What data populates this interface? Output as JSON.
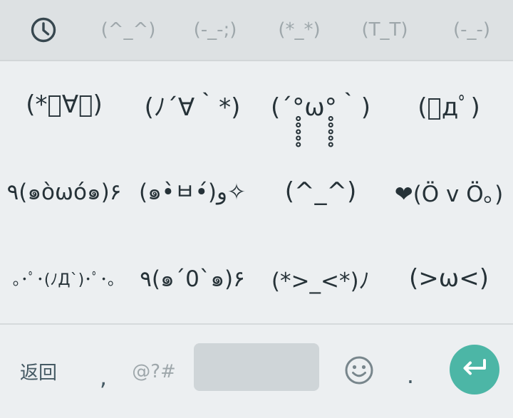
{
  "categories": {
    "recent_icon": "clock-icon",
    "items": [
      "(^_^)",
      "(-_-;)",
      "(*_*)",
      "(T_T)",
      "(-_-)"
    ]
  },
  "emoticons": [
    "(*ﾟ∀ﾟ)",
    "(ﾉ´∀｀*)",
    "(´°̥̥̥̥̥̥̥̥ω°̥̥̥̥̥̥̥̥｀)",
    "(ﾟдﾟ)",
    "٩(๑òωó๑)۶",
    "(๑•̀ㅂ•́)و✧",
    "(^_^)",
    "❤(Ö v Ö｡)",
    "｡･ﾟ･(ﾉД`)･ﾟ･｡",
    "٩(๑´0`๑)۶",
    "(*>_<*)ﾉ",
    "(>ω<)"
  ],
  "bottom": {
    "back_label": "返回",
    "comma_label": ",",
    "symbols_label": "@?#",
    "space_label": "",
    "emoji_icon": "smiley-icon",
    "period_label": ".",
    "enter_icon": "enter-icon"
  },
  "colors": {
    "accent": "#4cb6a6",
    "category_bar": "#dde1e3",
    "background": "#eceff1",
    "space_key": "#cfd5d8"
  }
}
